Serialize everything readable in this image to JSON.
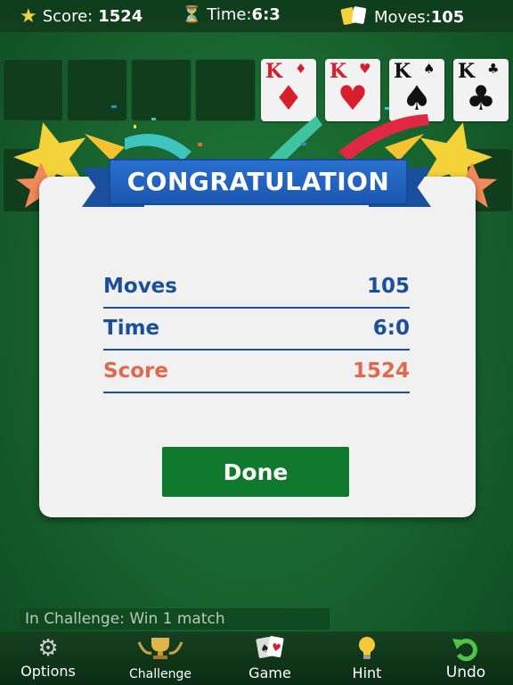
{
  "topbar": {
    "score_label": "Score:",
    "score_value": "1524",
    "time_label": "Time:",
    "time_value": "6:3",
    "moves_label": "Moves:",
    "moves_value": "105"
  },
  "foundation": [
    {
      "rank": "K",
      "suit": "diamonds",
      "symbol": "♦",
      "color": "#d91f2c"
    },
    {
      "rank": "K",
      "suit": "hearts",
      "symbol": "♥",
      "color": "#d91f2c"
    },
    {
      "rank": "K",
      "suit": "spades",
      "symbol": "♠",
      "color": "#111111"
    },
    {
      "rank": "K",
      "suit": "clubs",
      "symbol": "♣",
      "color": "#111111"
    }
  ],
  "dialog": {
    "banner_title": "CONGRATULATION",
    "rows": [
      {
        "label": "Moves",
        "value": "105",
        "color": "#1a4f9e"
      },
      {
        "label": "Time",
        "value": "6:0",
        "color": "#1a4f9e"
      },
      {
        "label": "Score",
        "value": "1524",
        "color": "#e2684d"
      }
    ],
    "done_label": "Done"
  },
  "challenge_text": "In Challenge: Win 1 match",
  "bottombar": {
    "tabs": [
      {
        "label": "Options",
        "icon": "gear-icon"
      },
      {
        "label": "Challenge",
        "icon": "trophy-icon"
      },
      {
        "label": "Game",
        "icon": "cards-icon"
      },
      {
        "label": "Hint",
        "icon": "lightbulb-icon"
      },
      {
        "label": "Undo",
        "icon": "undo-arrow-icon"
      }
    ]
  },
  "colors": {
    "felt": "#17632e",
    "banner_blue": "#2a6fcf",
    "done_green": "#0f7a2e"
  }
}
